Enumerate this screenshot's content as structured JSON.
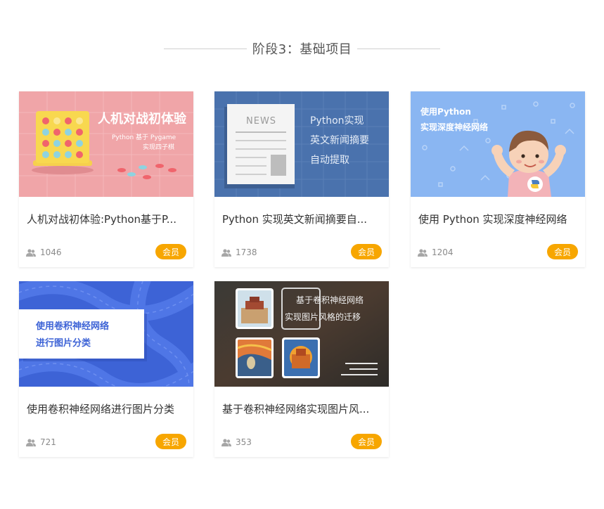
{
  "section": {
    "title": "阶段3：基础项目"
  },
  "badge_color": "#f7a600",
  "cards": [
    {
      "title": "人机对战初体验:Python基于P...",
      "count": "1046",
      "badge": "会员",
      "thumb": {
        "line1": "人机对战初体验",
        "line2": "Python 基于 Pygame",
        "line3": "实现四子棋"
      }
    },
    {
      "title": "Python 实现英文新闻摘要自...",
      "count": "1738",
      "badge": "会员",
      "thumb": {
        "tag": "NEWS",
        "line1": "Python实现",
        "line2": "英文新闻摘要",
        "line3": "自动提取"
      }
    },
    {
      "title": "使用 Python 实现深度神经网络",
      "count": "1204",
      "badge": "会员",
      "thumb": {
        "line1": "使用Python",
        "line2": "实现深度神经网络"
      }
    },
    {
      "title": "使用卷积神经网络进行图片分类",
      "count": "721",
      "badge": "会员",
      "thumb": {
        "line1": "使用卷积神经网络",
        "line2": "进行图片分类"
      }
    },
    {
      "title": "基于卷积神经网络实现图片风...",
      "count": "353",
      "badge": "会员",
      "thumb": {
        "line1": "基于卷积神经网络",
        "line2": "实现图片风格的迁移"
      }
    }
  ]
}
